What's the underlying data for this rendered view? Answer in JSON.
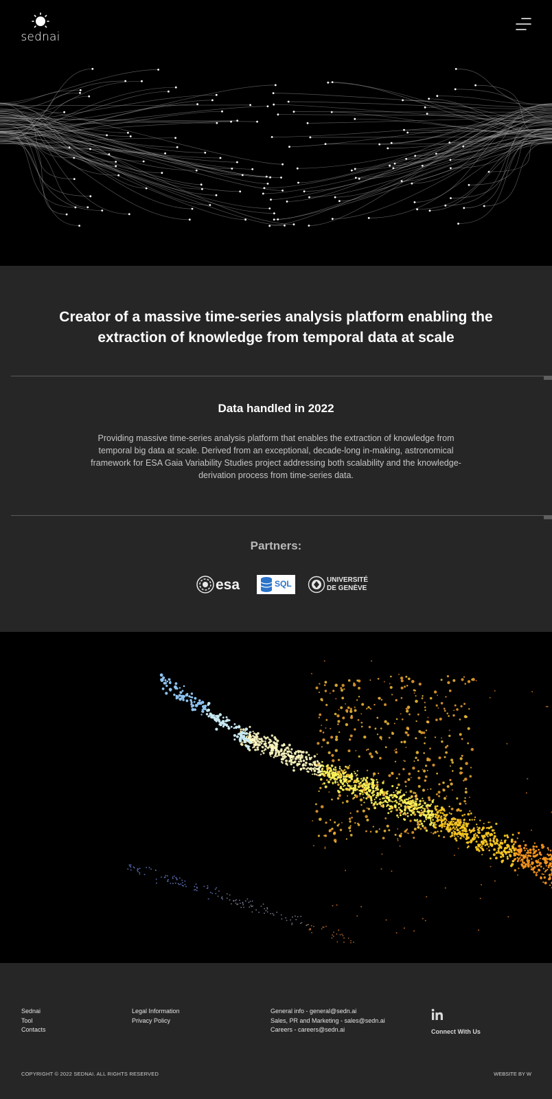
{
  "brand": {
    "name": "sednai"
  },
  "icons": {
    "logo": "sun-icon",
    "menu": "hamburger-menu-icon",
    "linkedin": "linkedin-icon"
  },
  "colors": {
    "hero_bg": "#000000",
    "section_bg": "#262626",
    "text_primary": "#ffffff",
    "text_muted": "#c6c6c6",
    "divider": "#5a5a5a",
    "accent_blue": "#2a73c9"
  },
  "intro": {
    "headline": "Creator of a massive time-series analysis platform enabling the extraction of knowledge from temporal data at scale"
  },
  "data_section": {
    "title": "Data handled in 2022",
    "description": "Providing massive time-series analysis platform that enables the extraction of knowledge from temporal big data at scale. Derived from an exceptional, decade-long in-making, astronomical framework for ESA Gaia Variability Studies project addressing both scalability and the knowledge-derivation process from time-series data."
  },
  "partners": {
    "title": "Partners:",
    "items": [
      {
        "name": "esa",
        "label": "esa"
      },
      {
        "name": "sql",
        "label": "SQL"
      },
      {
        "name": "geneve",
        "line1": "UNIVERSITÉ",
        "line2": "DE GENÈVE"
      }
    ]
  },
  "footer": {
    "nav": [
      "Sednai",
      "Tool",
      "Contacts"
    ],
    "legal": [
      "Legal Information",
      "Privacy Policy"
    ],
    "contacts": [
      "General info - general@sedn.ai",
      "Sales, PR and Marketing - sales@sedn.ai",
      "Careers - careers@sedn.ai"
    ],
    "connect": "Connect With Us",
    "copyright": "COPYRIGHT © 2022 SEDNAI. ALL RIGHTS RESERVED",
    "credit": "WEBSITE BY W"
  }
}
